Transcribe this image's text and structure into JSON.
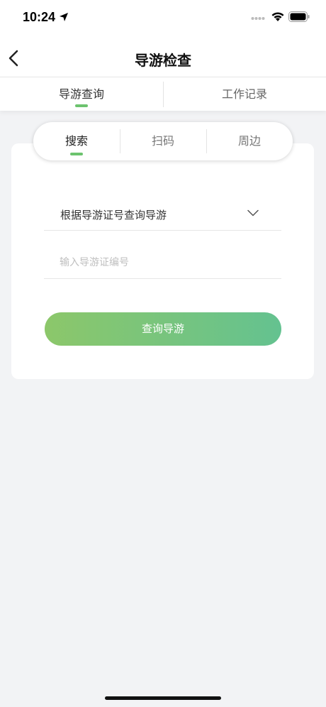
{
  "status_bar": {
    "time": "10:24"
  },
  "nav": {
    "title": "导游检查"
  },
  "top_tabs": [
    {
      "label": "导游查询",
      "active": true
    },
    {
      "label": "工作记录",
      "active": false
    }
  ],
  "segments": [
    {
      "label": "搜索",
      "active": true
    },
    {
      "label": "扫码",
      "active": false
    },
    {
      "label": "周边",
      "active": false
    }
  ],
  "search_form": {
    "query_type": "根据导游证号查询导游",
    "input_value": "",
    "input_placeholder": "输入导游证编号",
    "submit_label": "查询导游"
  },
  "colors": {
    "accent": "#6cc36e",
    "button_gradient_start": "#8cc76a",
    "button_gradient_end": "#64c290",
    "background": "#f2f3f5"
  }
}
